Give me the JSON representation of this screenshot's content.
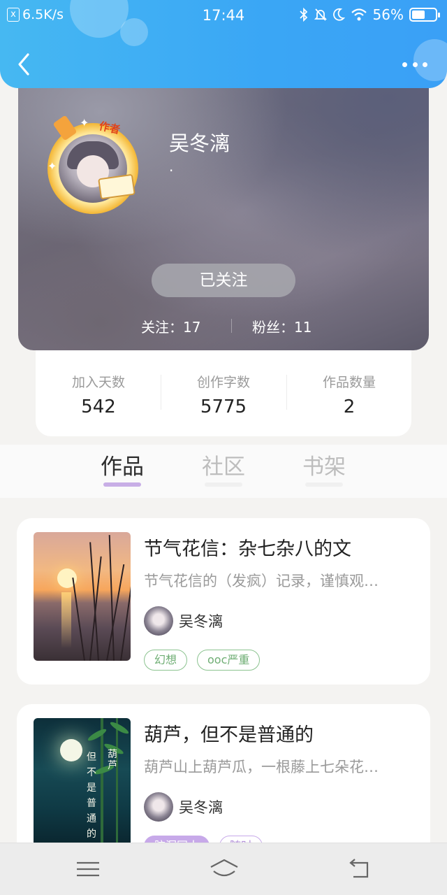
{
  "status_bar": {
    "speed": "6.5K/s",
    "time": "17:44",
    "battery": "56%",
    "battery_level": 0.56
  },
  "profile": {
    "name": "吴冬漓",
    "bio": "·",
    "avatar_tag": "作者",
    "follow_button": "已关注",
    "following_label": "关注：17",
    "followers_label": "粉丝：11"
  },
  "stats": [
    {
      "label": "加入天数",
      "value": "542"
    },
    {
      "label": "创作字数",
      "value": "5775"
    },
    {
      "label": "作品数量",
      "value": "2"
    }
  ],
  "tabs": [
    {
      "label": "作品",
      "active": true
    },
    {
      "label": "社区",
      "active": false
    },
    {
      "label": "书架",
      "active": false
    }
  ],
  "works": [
    {
      "title": "节气花信：杂七杂八的文",
      "description": "节气花信的（发疯）记录，谨慎观…",
      "author": "吴冬漓",
      "tags": [
        "幻想",
        "ooc严重"
      ]
    },
    {
      "title": "葫芦，但不是普通的",
      "description": "葫芦山上葫芦瓜，一根藤上七朵花…",
      "author": "吴冬漓",
      "cover_text": [
        "葫",
        "芦",
        "但",
        "不",
        "是",
        "普",
        "通",
        "的"
      ],
      "tags": [
        "脑洞同人",
        "随时"
      ]
    }
  ]
}
